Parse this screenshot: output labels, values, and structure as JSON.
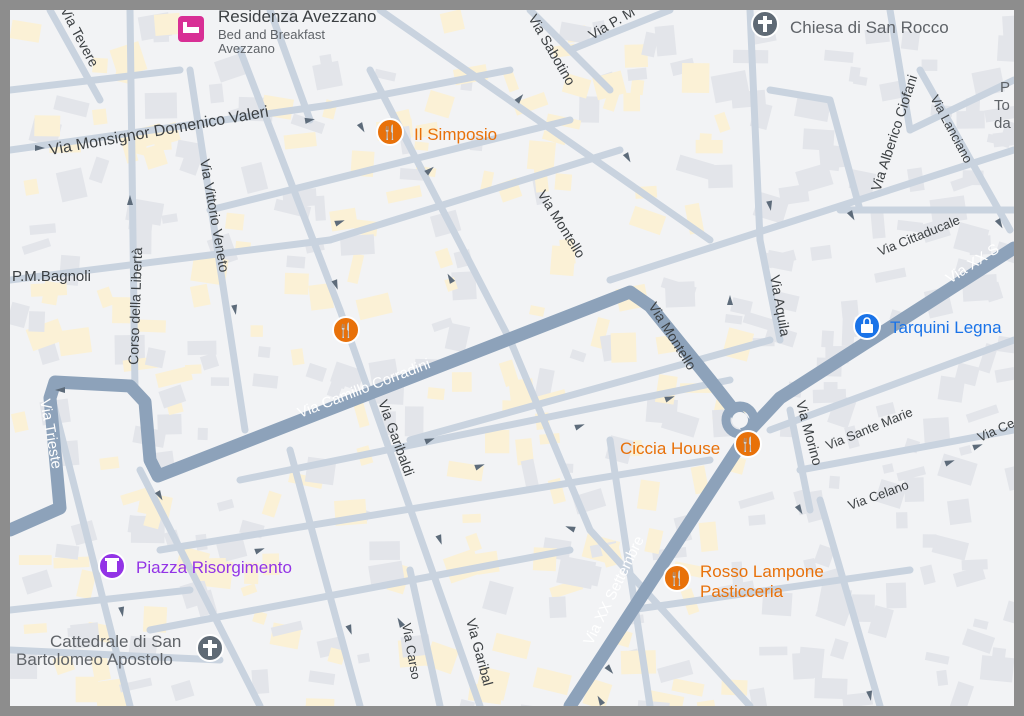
{
  "map": {
    "colors": {
      "background": "#f2f3f5",
      "block": "#e4e6ea",
      "building": "#fdf4dd",
      "minor_road": "#c8d2de",
      "main_road": "#8aa0b8",
      "street_label": "#3c4043",
      "restaurant": "#e8710a",
      "lodging": "#d82f95",
      "church": "#5f6a75",
      "shop": "#1a73e8",
      "landmark": "#9334e6"
    },
    "streets": [
      {
        "name": "Via Tevere"
      },
      {
        "name": "Via Monsignor Domenico Valeri"
      },
      {
        "name": "Via Sabotino"
      },
      {
        "name": "Via P. M"
      },
      {
        "name": "Via Alberico Ciofani"
      },
      {
        "name": "Via Lanciano"
      },
      {
        "name": "P.M.Bagnoli"
      },
      {
        "name": "Corso della Libertà"
      },
      {
        "name": "Via Vittorio Veneto"
      },
      {
        "name": "Via Montello"
      },
      {
        "name": "Via Montello"
      },
      {
        "name": "Via Cittaducale"
      },
      {
        "name": "Via XX S"
      },
      {
        "name": "Via Aquila"
      },
      {
        "name": "Via Camillo Corradini"
      },
      {
        "name": "Via Trieste"
      },
      {
        "name": "Via Garibaldi"
      },
      {
        "name": "Via Sante Marie"
      },
      {
        "name": "Via Morino"
      },
      {
        "name": "Via Ce"
      },
      {
        "name": "Via Celano"
      },
      {
        "name": "Via XX Settembre"
      },
      {
        "name": "Via Carso"
      },
      {
        "name": "Via Garibal"
      }
    ],
    "places": [
      {
        "name": "Residenza Avezzano",
        "sub1": "Bed and Breakfast",
        "sub2": "Avezzano",
        "icon": "bed-icon"
      },
      {
        "name": "Chiesa di San Rocco",
        "icon": "cross-icon"
      },
      {
        "name": "Il Simposio",
        "icon": "fork-knife-icon"
      },
      {
        "name": "Tarquini Legna",
        "icon": "shopping-bag-icon"
      },
      {
        "name": "Ciccia House",
        "icon": "fork-knife-icon"
      },
      {
        "name": "Rosso Lampone",
        "sub1": "Pasticceria",
        "icon": "fork-knife-icon"
      },
      {
        "name": "Piazza Risorgimento",
        "icon": "tower-icon"
      },
      {
        "name": "Cattedrale di San",
        "sub1": "Bartolomeo Apostolo",
        "icon": "cross-icon"
      },
      {
        "name": "",
        "icon": "fork-knife-icon"
      }
    ],
    "edge_text": [
      "P",
      "To",
      "da"
    ]
  }
}
